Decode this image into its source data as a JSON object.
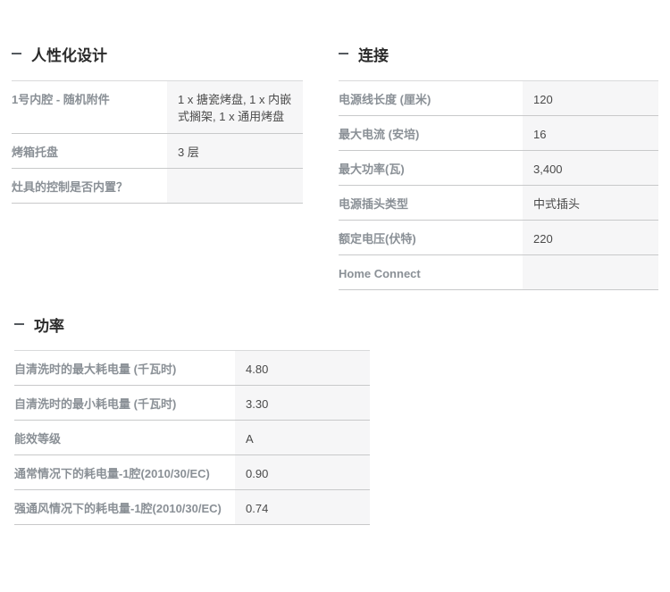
{
  "sections": {
    "design": {
      "title": "人性化设计",
      "rows": [
        {
          "label": "1号内腔 - 随机附件",
          "value": "1 x 搪瓷烤盘, 1 x 内嵌式搁架, 1 x 通用烤盘"
        },
        {
          "label": "烤箱托盘",
          "value": "3 层"
        },
        {
          "label": "灶具的控制是否内置？",
          "value": ""
        }
      ]
    },
    "connection": {
      "title": "连接",
      "rows": [
        {
          "label": "电源线长度 (厘米)",
          "value": "120"
        },
        {
          "label": "最大电流 (安培)",
          "value": "16"
        },
        {
          "label": "最大功率(瓦)",
          "value": "3,400"
        },
        {
          "label": "电源插头类型",
          "value": "中式插头"
        },
        {
          "label": "额定电压(伏特)",
          "value": "220"
        },
        {
          "label": "Home Connect",
          "value": ""
        }
      ]
    },
    "power": {
      "title": "功率",
      "rows": [
        {
          "label": "自清洗时的最大耗电量 (千瓦时)",
          "value": "4.80"
        },
        {
          "label": "自清洗时的最小耗电量 (千瓦时)",
          "value": "3.30"
        },
        {
          "label": "能效等级",
          "value": "A"
        },
        {
          "label": "通常情况下的耗电量-1腔(2010/30/EC)",
          "value": "0.90"
        },
        {
          "label": "强通风情况下的耗电量-1腔(2010/30/EC)",
          "value": "0.74"
        }
      ]
    }
  }
}
